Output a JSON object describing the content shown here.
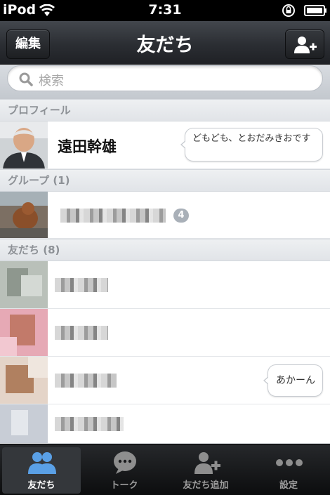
{
  "status_bar": {
    "carrier": "iPod",
    "time": "7:31"
  },
  "nav": {
    "edit_label": "編集",
    "title": "友だち",
    "add_friend_icon": "add-person-icon"
  },
  "search": {
    "placeholder": "検索"
  },
  "sections": {
    "profile": {
      "title": "プロフィール"
    },
    "groups": {
      "title": "グループ",
      "count": "(1)"
    },
    "friends": {
      "title": "友だち",
      "count": "(8)"
    }
  },
  "profile": {
    "name": "遠田幹雄",
    "status_message": "どもども、とおだみきおです"
  },
  "groups": [
    {
      "member_count": "4"
    }
  ],
  "friends": [
    {
      "status_message": ""
    },
    {
      "status_message": ""
    },
    {
      "status_message": "あかーん"
    },
    {
      "status_message": ""
    }
  ],
  "tabs": [
    {
      "label": "友だち",
      "icon": "friends-icon",
      "active": true
    },
    {
      "label": "トーク",
      "icon": "chat-icon",
      "active": false
    },
    {
      "label": "友だち追加",
      "icon": "add-friend-icon",
      "active": false
    },
    {
      "label": "設定",
      "icon": "more-icon",
      "active": false
    }
  ],
  "colors": {
    "accent_blue": "#5aa0e6",
    "nav_dark": "#2b2e33"
  }
}
